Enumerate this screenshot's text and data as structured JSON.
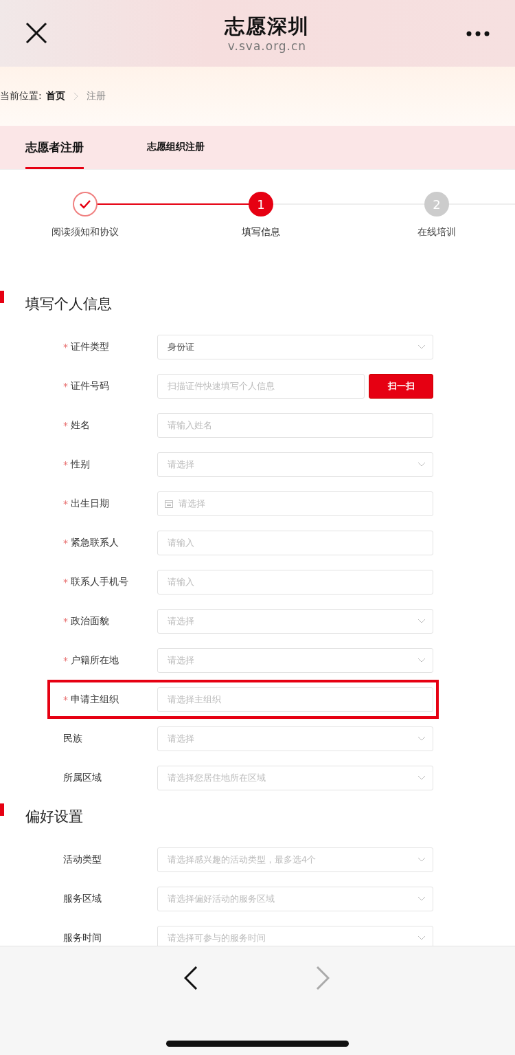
{
  "header": {
    "title": "志愿深圳",
    "url": "v.sva.org.cn"
  },
  "breadcrumb": {
    "label": "当前位置:",
    "items": [
      "首页",
      "注册"
    ]
  },
  "tabs": [
    {
      "label": "志愿者注册",
      "selected": true
    },
    {
      "label": "志愿组织注册",
      "selected": false
    }
  ],
  "steps": [
    {
      "label": "阅读须知和协议",
      "completed": true,
      "selected": false
    },
    {
      "label": "填写信息",
      "number": "1",
      "completed": false,
      "selected": true
    },
    {
      "label": "在线培训",
      "number": "2",
      "completed": false,
      "selected": false
    }
  ],
  "sections": [
    {
      "title": "填写个人信息",
      "fields": [
        {
          "label": "证件类型",
          "required_mark": "*",
          "kind": "select",
          "value": "身份证"
        },
        {
          "label": "证件号码",
          "required_mark": "*",
          "kind": "scan",
          "placeholder": "扫描证件快速填写个人信息",
          "button": "扫一扫"
        },
        {
          "label": "姓名",
          "required_mark": "*",
          "kind": "input",
          "placeholder": "请输入姓名"
        },
        {
          "label": "性别",
          "required_mark": "*",
          "kind": "select",
          "placeholder": "请选择"
        },
        {
          "label": "出生日期",
          "required_mark": "*",
          "kind": "date",
          "placeholder": "请选择"
        },
        {
          "label": "紧急联系人",
          "required_mark": "*",
          "kind": "input",
          "placeholder": "请输入"
        },
        {
          "label": "联系人手机号",
          "required_mark": "*",
          "kind": "input",
          "placeholder": "请输入"
        },
        {
          "label": "政治面貌",
          "required_mark": "*",
          "kind": "select",
          "placeholder": "请选择"
        },
        {
          "label": "户籍所在地",
          "required_mark": "*",
          "kind": "select",
          "placeholder": "请选择"
        },
        {
          "label": "申请主组织",
          "required_mark": "*",
          "kind": "input",
          "placeholder": "请选择主组织",
          "highlighted": true
        },
        {
          "label": "民族",
          "kind": "select",
          "placeholder": "请选择"
        },
        {
          "label": "所属区域",
          "kind": "select",
          "placeholder": "请选择您居住地所在区域"
        }
      ]
    },
    {
      "title": "偏好设置",
      "fields": [
        {
          "label": "活动类型",
          "kind": "select",
          "placeholder": "请选择感兴趣的活动类型，最多选4个"
        },
        {
          "label": "服务区域",
          "kind": "select",
          "placeholder": "请选择偏好活动的服务区域"
        },
        {
          "label": "服务时间",
          "kind": "select",
          "placeholder": "请选择可参与的服务时间"
        }
      ]
    }
  ],
  "toolbar": {
    "back_disabled": false,
    "forward_disabled": true
  }
}
